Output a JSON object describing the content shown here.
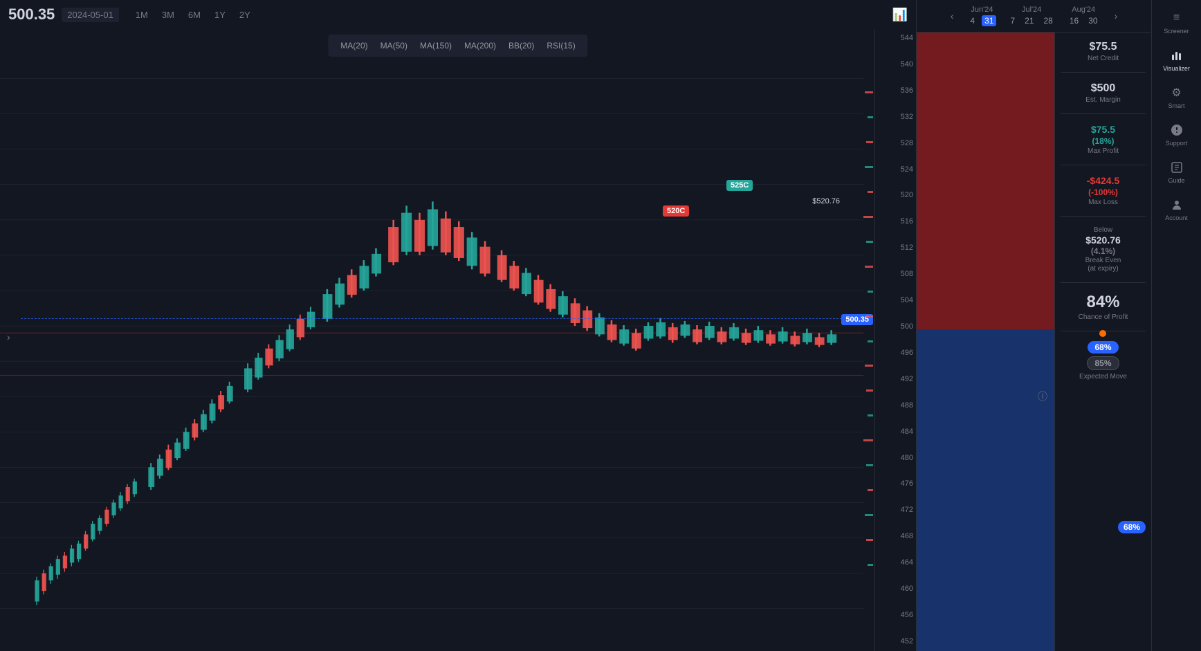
{
  "header": {
    "price": "500.35",
    "date": "2024-05-01",
    "chart_icon": "📊"
  },
  "time_periods": [
    "1M",
    "3M",
    "6M",
    "1Y",
    "2Y"
  ],
  "indicators": [
    "MA(20)",
    "MA(50)",
    "MA(150)",
    "MA(200)",
    "BB(20)",
    "RSI(15)"
  ],
  "date_nav": {
    "prev_arrow": "‹",
    "next_arrow": "›",
    "months": [
      {
        "name": "Jun'24",
        "days": [
          "4",
          "31"
        ]
      },
      {
        "name": "Jul'24",
        "days": [
          "7",
          "21",
          "28"
        ]
      },
      {
        "name": "Aug'24",
        "days": [
          "16",
          "30"
        ]
      }
    ],
    "active_day": "31"
  },
  "price_levels": [
    "544",
    "540",
    "536",
    "532",
    "528",
    "524",
    "520",
    "516",
    "512",
    "508",
    "504",
    "500",
    "496",
    "492",
    "488",
    "484",
    "480",
    "476",
    "472",
    "468",
    "464",
    "460",
    "456",
    "452"
  ],
  "chart_labels": {
    "label_520c": "520C",
    "label_525c": "525C",
    "label_price": "500.35",
    "label_breakeven": "$520.76"
  },
  "stats": {
    "net_credit_value": "$75.5",
    "net_credit_label": "Net Credit",
    "est_margin_value": "$500",
    "est_margin_label": "Est. Margin",
    "max_profit_value": "$75.5",
    "max_profit_pct": "(18%)",
    "max_profit_label": "Max Profit",
    "max_loss_value": "-$424.5",
    "max_loss_pct": "(-100%)",
    "max_loss_label": "Max Loss",
    "break_even_prefix": "Below",
    "break_even_price": "$520.76",
    "break_even_pct": "(4.1%)",
    "break_even_label": "Break Even",
    "break_even_sublabel": "(at expiry)",
    "chance_value": "84%",
    "chance_label": "Chance of Profit",
    "expected_move_68": "68%",
    "expected_move_85": "85%",
    "expected_move_label": "Expected Move",
    "badge_68_right": "68%"
  },
  "right_sidebar": [
    {
      "label": "Screener",
      "icon": "≡"
    },
    {
      "label": "Visualizer",
      "icon": "◈"
    },
    {
      "label": "Smart",
      "icon": "⚙"
    },
    {
      "label": "Support",
      "icon": "💬"
    },
    {
      "label": "Guide",
      "icon": "▶"
    },
    {
      "label": "Account",
      "icon": "👤"
    }
  ]
}
